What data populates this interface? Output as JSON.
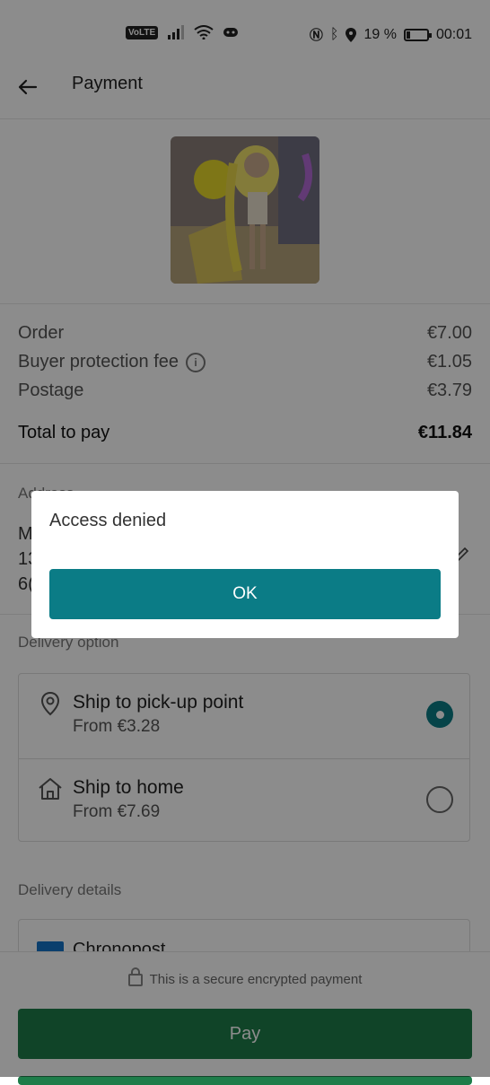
{
  "status_bar": {
    "volte": "VoLTE",
    "battery_percent": "19 %",
    "time": "00:01"
  },
  "header": {
    "title": "Payment"
  },
  "summary": {
    "order_label": "Order",
    "order_value": "€7.00",
    "protection_label": "Buyer protection fee",
    "protection_value": "€1.05",
    "postage_label": "Postage",
    "postage_value": "€3.79",
    "total_label": "Total to pay",
    "total_value": "€11.84"
  },
  "address": {
    "label": "Address",
    "line1_partial": "M",
    "line2_partial": "13",
    "line3_partial": "6("
  },
  "delivery": {
    "label": "Delivery option",
    "options": [
      {
        "title": "Ship to pick-up point",
        "subtitle": "From €3.28",
        "selected": true
      },
      {
        "title": "Ship to home",
        "subtitle": "From €7.69",
        "selected": false
      }
    ]
  },
  "details": {
    "label": "Delivery details",
    "carrier": "Chronopost"
  },
  "footer": {
    "secure_text": "This is a secure encrypted payment",
    "pay_label": "Pay"
  },
  "dialog": {
    "title": "Access denied",
    "ok_label": "OK"
  },
  "colors": {
    "accent": "#0b7c86",
    "pay": "#1e7d4a"
  }
}
